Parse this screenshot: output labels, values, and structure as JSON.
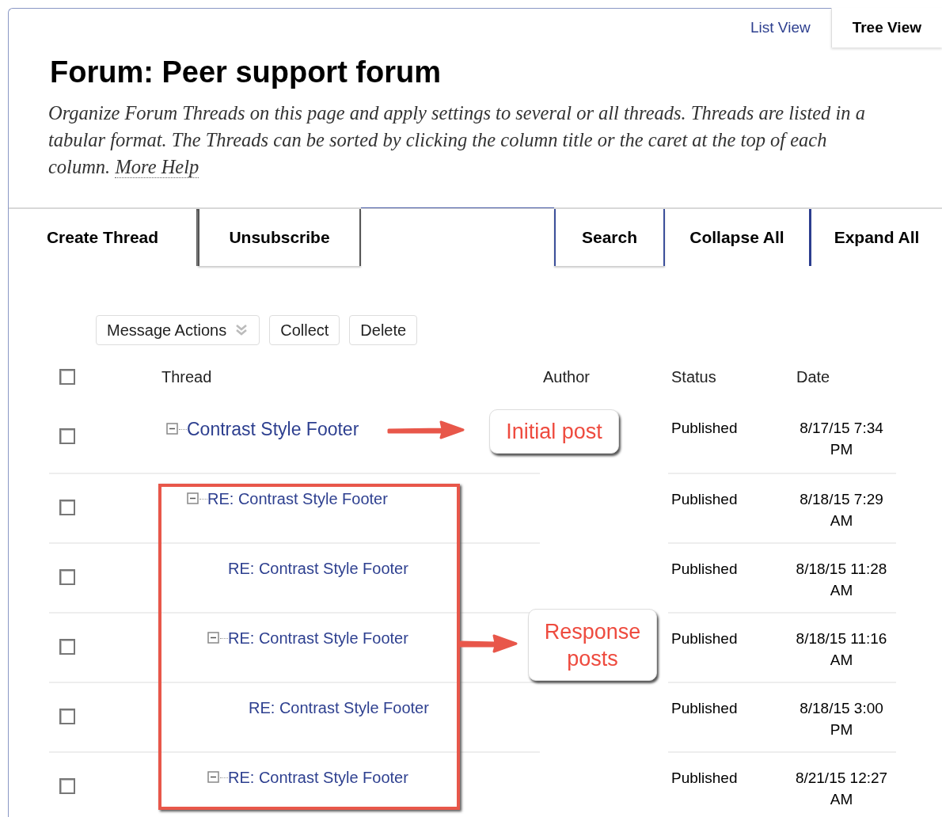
{
  "view_tabs": [
    {
      "label": "List View",
      "selected": false
    },
    {
      "label": "Tree View",
      "selected": true
    }
  ],
  "title": "Forum: Peer support forum",
  "description": "Organize Forum Threads on this page and apply settings to several or all threads. Threads are listed in a tabular format. The Threads can be sorted by clicking the column title or the caret at the top of each column.",
  "help_link": "More Help",
  "toolbar_left": [
    "Create Thread",
    "Unsubscribe"
  ],
  "toolbar_right": [
    "Search",
    "Collapse All",
    "Expand All"
  ],
  "actions": [
    {
      "label": "Message Actions",
      "kind": "menu"
    },
    {
      "label": "Collect",
      "kind": "button"
    },
    {
      "label": "Delete",
      "kind": "button"
    }
  ],
  "table": {
    "select_all_checked": false,
    "columns": [
      "Thread",
      "Author",
      "Status",
      "Date"
    ],
    "rows": [
      {
        "title": "Contrast Style Footer",
        "status": "Published",
        "date": "8/17/15 7:34 PM",
        "checked": false,
        "expanded": true,
        "children": [
          {
            "title": "RE: Contrast Style Footer",
            "status": "Published",
            "date": "8/18/15 7:29 AM",
            "checked": false,
            "expanded": true,
            "children": [
              {
                "title": "RE: Contrast Style Footer",
                "status": "Published",
                "date": "8/18/15 11:28 AM",
                "checked": false,
                "expanded": false
              },
              {
                "title": "RE: Contrast Style Footer",
                "status": "Published",
                "date": "8/18/15 11:16 AM",
                "checked": false,
                "expanded": true,
                "children": [
                  {
                    "title": "RE: Contrast Style Footer",
                    "status": "Published",
                    "date": "8/18/15 3:00 PM",
                    "checked": false,
                    "expanded": false
                  }
                ]
              },
              {
                "title": "RE: Contrast Style Footer",
                "status": "Published",
                "date": "8/21/15 12:27 AM",
                "checked": false,
                "expanded": true
              }
            ]
          }
        ]
      }
    ]
  },
  "annotations": [
    {
      "text": "Initial post"
    },
    {
      "text": "Response posts"
    }
  ]
}
